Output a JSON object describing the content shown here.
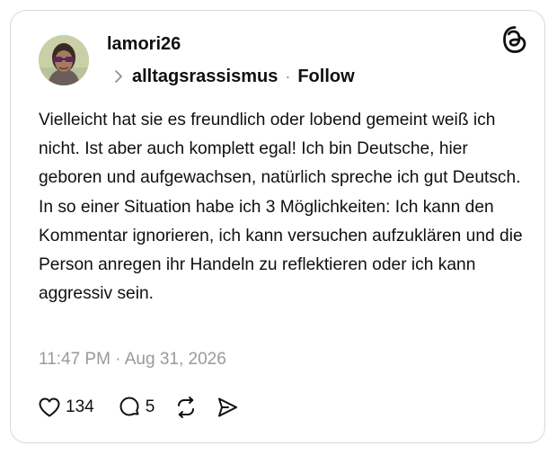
{
  "post": {
    "username": "lamori26",
    "reply_to": "alltagsrassismus",
    "separator": "·",
    "follow_label": "Follow",
    "text": "Vielleicht hat sie es freundlich oder lobend gemeint weiß ich nicht. Ist aber auch komplett egal! Ich bin Deutsche, hier geboren und aufgewachsen, natürlich spreche ich gut Deutsch. In so einer Situation habe ich 3 Möglichkeiten: Ich kann den Kommentar ignorieren, ich kann versuchen aufzuklären und die Person anregen ihr Handeln zu reflektieren oder ich kann aggressiv sein.",
    "timestamp": "11:47 PM · Aug 31, 2026"
  },
  "actions": {
    "likes": "134",
    "replies": "5"
  },
  "icons": {
    "brand": "threads-logo-icon",
    "chevron": "chevron-right-icon",
    "like": "heart-icon",
    "reply": "comment-icon",
    "repost": "repost-icon",
    "share": "send-icon"
  },
  "colors": {
    "text": "#101010",
    "muted": "#9a9a9a",
    "border": "#d9d9d9",
    "background": "#ffffff"
  }
}
